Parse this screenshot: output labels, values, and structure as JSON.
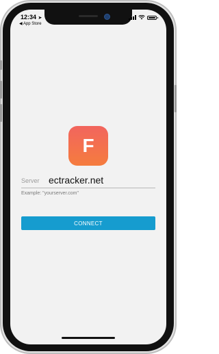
{
  "status_bar": {
    "time": "12:34",
    "back_label": "◀ App Store"
  },
  "app": {
    "icon_letter": "F"
  },
  "form": {
    "server_label": "Server",
    "server_value": "ectracker.net",
    "server_hint": "Example: \"yourserver.com\"",
    "connect_label": "CONNECT"
  },
  "colors": {
    "accent": "#169ccf",
    "icon_gradient_start": "#f2655e",
    "icon_gradient_end": "#f57c3e",
    "screen_background": "#f2f2f2"
  },
  "icons": {
    "location": "location-arrow-icon",
    "signal": "cellular-signal-icon",
    "wifi": "wifi-icon",
    "battery": "battery-icon"
  },
  "device_state": {
    "battery_level_percent": 100
  }
}
